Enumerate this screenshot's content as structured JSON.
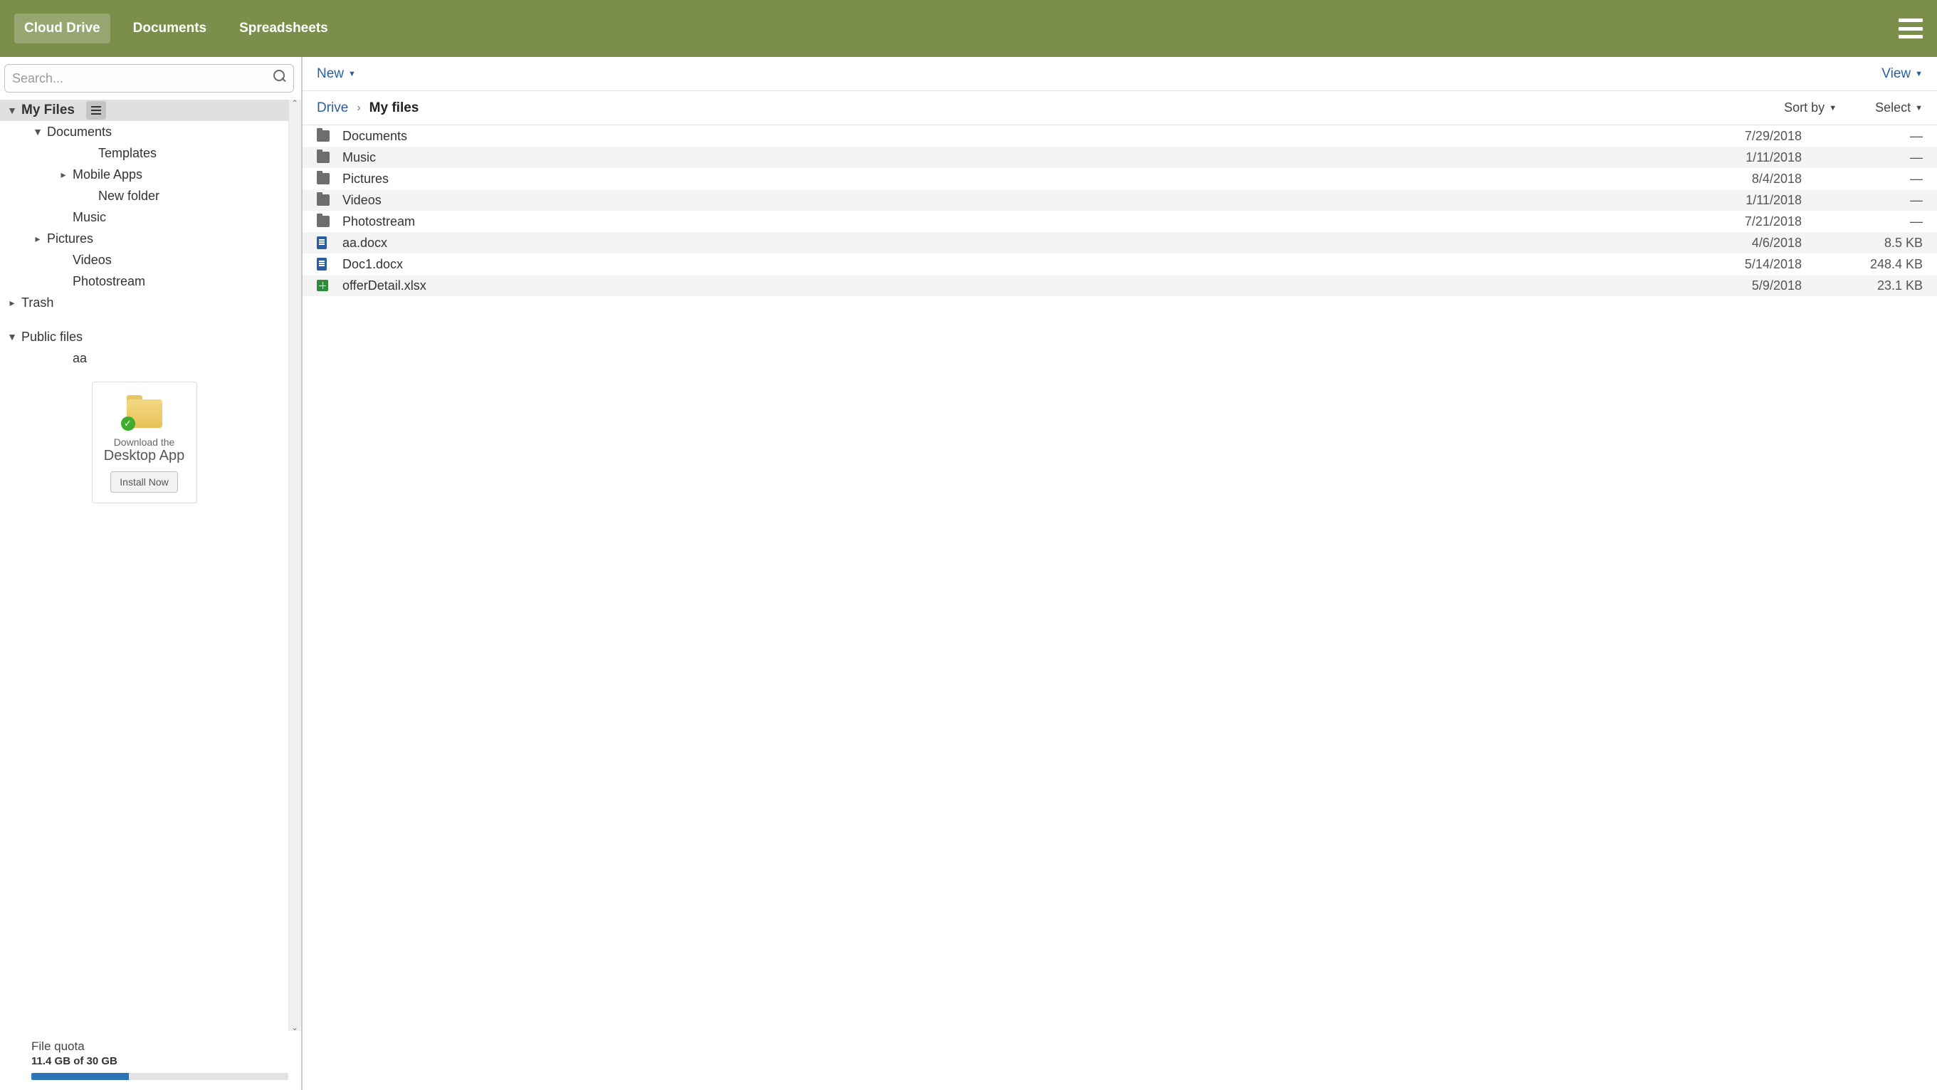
{
  "header": {
    "tabs": [
      {
        "label": "Cloud Drive",
        "active": true
      },
      {
        "label": "Documents",
        "active": false
      },
      {
        "label": "Spreadsheets",
        "active": false
      }
    ]
  },
  "search": {
    "placeholder": "Search..."
  },
  "tree": {
    "root": "My Files",
    "trash": "Trash",
    "public": "Public files",
    "public_child": "aa",
    "items": {
      "documents": "Documents",
      "templates": "Templates",
      "mobile_apps": "Mobile Apps",
      "new_folder": "New folder",
      "music": "Music",
      "pictures": "Pictures",
      "videos": "Videos",
      "photostream": "Photostream"
    }
  },
  "promo": {
    "line1": "Download the",
    "line2": "Desktop App",
    "button": "Install Now"
  },
  "quota": {
    "title": "File quota",
    "usage": "11.4 GB of 30 GB",
    "percent": 38
  },
  "actions": {
    "new": "New",
    "view": "View",
    "sort_by": "Sort by",
    "select": "Select"
  },
  "breadcrumb": {
    "root": "Drive",
    "current": "My files"
  },
  "file_list": [
    {
      "icon": "folder",
      "name": "Documents",
      "date": "7/29/2018",
      "size": "—"
    },
    {
      "icon": "folder",
      "name": "Music",
      "date": "1/11/2018",
      "size": "—"
    },
    {
      "icon": "folder",
      "name": "Pictures",
      "date": "8/4/2018",
      "size": "—"
    },
    {
      "icon": "folder",
      "name": "Videos",
      "date": "1/11/2018",
      "size": "—"
    },
    {
      "icon": "folder",
      "name": "Photostream",
      "date": "7/21/2018",
      "size": "—"
    },
    {
      "icon": "doc",
      "name": "aa.docx",
      "date": "4/6/2018",
      "size": "8.5 KB"
    },
    {
      "icon": "doc",
      "name": "Doc1.docx",
      "date": "5/14/2018",
      "size": "248.4 KB"
    },
    {
      "icon": "sheet",
      "name": "offerDetail.xlsx",
      "date": "5/9/2018",
      "size": "23.1 KB"
    }
  ]
}
